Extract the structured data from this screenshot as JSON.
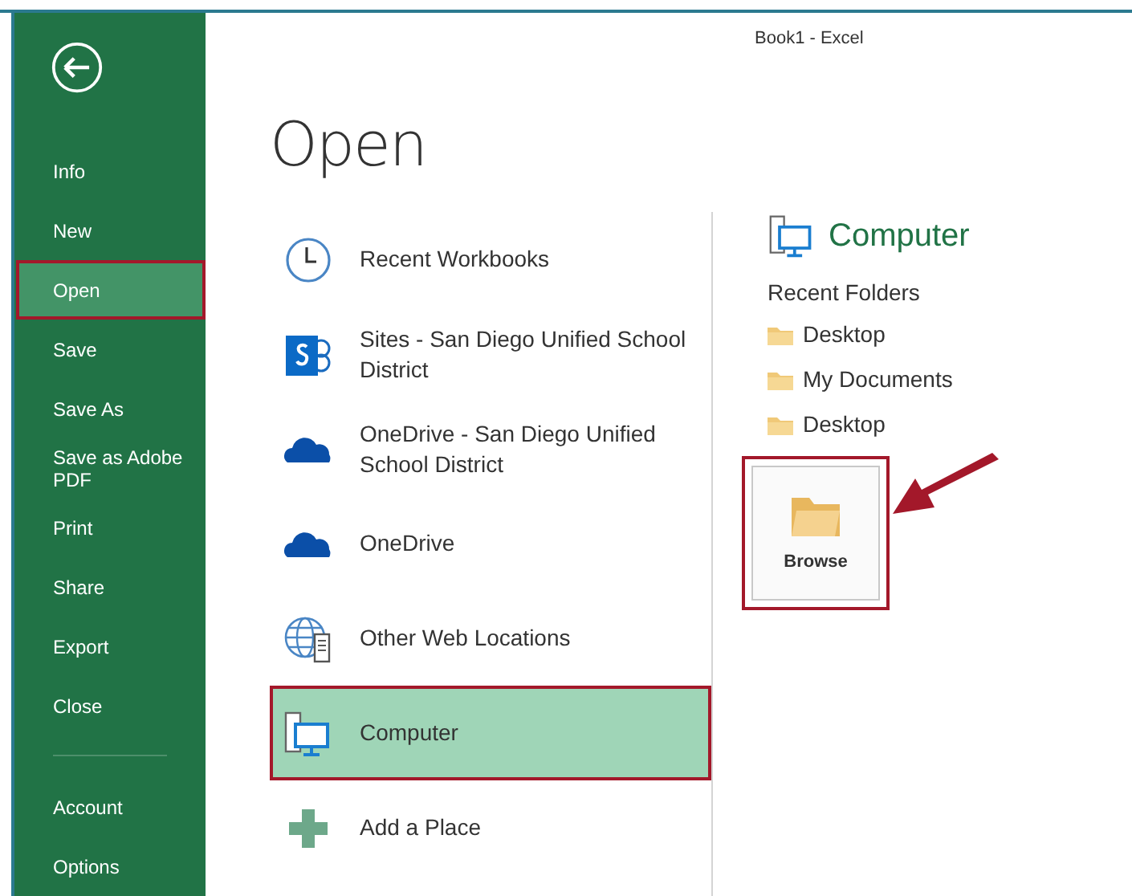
{
  "window": {
    "title": "Book1 - Excel"
  },
  "sidebar": {
    "items": [
      {
        "label": "Info",
        "selected": false
      },
      {
        "label": "New",
        "selected": false
      },
      {
        "label": "Open",
        "selected": true
      },
      {
        "label": "Save",
        "selected": false
      },
      {
        "label": "Save As",
        "selected": false
      },
      {
        "label": "Save as Adobe PDF",
        "selected": false
      },
      {
        "label": "Print",
        "selected": false
      },
      {
        "label": "Share",
        "selected": false
      },
      {
        "label": "Export",
        "selected": false
      },
      {
        "label": "Close",
        "selected": false
      }
    ],
    "bottom_items": [
      {
        "label": "Account",
        "selected": false
      },
      {
        "label": "Options",
        "selected": false
      }
    ]
  },
  "page_title": "Open",
  "places": [
    {
      "kind": "clock",
      "label": "Recent Workbooks",
      "selected": false
    },
    {
      "kind": "sharepoint",
      "label": "Sites - San Diego Unified School District",
      "selected": false
    },
    {
      "kind": "cloud",
      "label": "OneDrive - San Diego Unified School District",
      "selected": false
    },
    {
      "kind": "cloud",
      "label": "OneDrive",
      "selected": false
    },
    {
      "kind": "globe",
      "label": "Other Web Locations",
      "selected": false
    },
    {
      "kind": "computer",
      "label": "Computer",
      "selected": true
    },
    {
      "kind": "plus",
      "label": "Add a Place",
      "selected": false
    }
  ],
  "detail": {
    "heading": "Computer",
    "recent_label": "Recent Folders",
    "folders": [
      "Desktop",
      "My Documents",
      "Desktop"
    ],
    "browse": "Browse"
  }
}
